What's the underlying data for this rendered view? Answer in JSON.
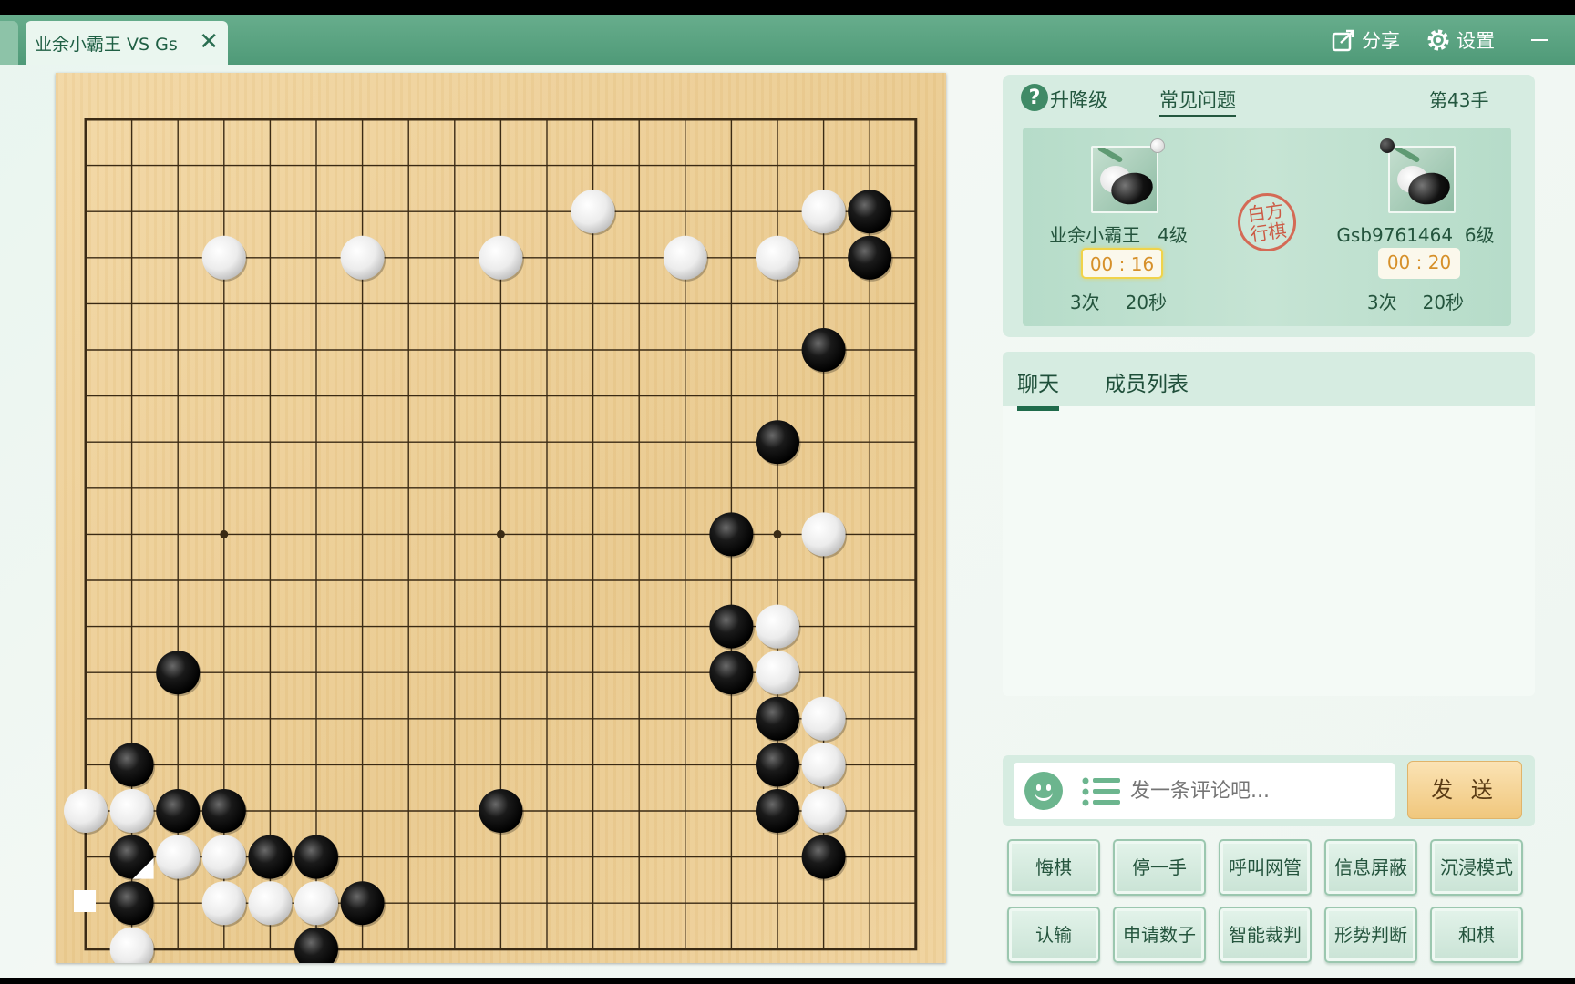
{
  "titlebar": {
    "tab_title": "业余小霸王 VS Gs",
    "share_label": "分享",
    "settings_label": "设置"
  },
  "info": {
    "upgrade_label": "升降级",
    "faq_label": "常见问题",
    "move_count": "第43手",
    "turn_stamp": "白方\n行棋",
    "left_player": {
      "name": "业余小霸王",
      "rank": "4级",
      "clock": "00 : 16",
      "periods": "3次",
      "period_time": "20秒",
      "stone": "white"
    },
    "right_player": {
      "name": "Gsb9761464",
      "rank": "6级",
      "clock": "00 : 20",
      "periods": "3次",
      "period_time": "20秒",
      "stone": "black"
    }
  },
  "chat": {
    "tab_chat": "聊天",
    "tab_members": "成员列表",
    "placeholder": "发一条评论吧...",
    "send_label": "发 送"
  },
  "actions": {
    "row1": [
      "悔棋",
      "停一手",
      "呼叫网管",
      "信息屏蔽",
      "沉浸模式"
    ],
    "row2": [
      "认输",
      "申请数子",
      "智能裁判",
      "形势判断",
      "和棋"
    ]
  },
  "board": {
    "size": 19,
    "black": [
      [
        17,
        2
      ],
      [
        17,
        3
      ],
      [
        16,
        5
      ],
      [
        15,
        7
      ],
      [
        14,
        9
      ],
      [
        14,
        11
      ],
      [
        14,
        12
      ],
      [
        15,
        13
      ],
      [
        15,
        14
      ],
      [
        15,
        15
      ],
      [
        16,
        16
      ],
      [
        2,
        12
      ],
      [
        1,
        14
      ],
      [
        2,
        15
      ],
      [
        3,
        15
      ],
      [
        1,
        16
      ],
      [
        4,
        16
      ],
      [
        5,
        16
      ],
      [
        1,
        17
      ],
      [
        6,
        17
      ],
      [
        5,
        18
      ],
      [
        9,
        15
      ]
    ],
    "white": [
      [
        11,
        2
      ],
      [
        16,
        2
      ],
      [
        3,
        3
      ],
      [
        6,
        3
      ],
      [
        9,
        3
      ],
      [
        13,
        3
      ],
      [
        15,
        3
      ],
      [
        16,
        9
      ],
      [
        15,
        11
      ],
      [
        15,
        12
      ],
      [
        16,
        13
      ],
      [
        16,
        14
      ],
      [
        16,
        15
      ],
      [
        0,
        15
      ],
      [
        1,
        15
      ],
      [
        2,
        16
      ],
      [
        3,
        16
      ],
      [
        3,
        17
      ],
      [
        4,
        17
      ],
      [
        5,
        17
      ],
      [
        1,
        18
      ]
    ],
    "last_move": [
      1,
      16
    ]
  },
  "colors": {
    "accent": "#4f9a78",
    "clock_text": "#d6902a",
    "stamp": "#d46a55"
  }
}
